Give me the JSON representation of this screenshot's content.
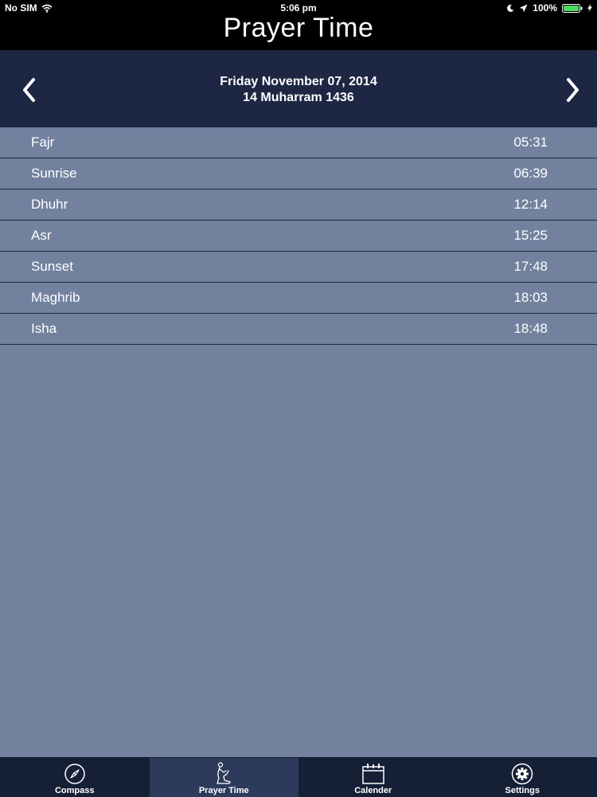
{
  "status_bar": {
    "carrier": "No SIM",
    "time": "5:06 pm",
    "battery": "100%"
  },
  "title": "Prayer Time",
  "date_header": {
    "gregorian": "Friday November 07, 2014",
    "hijri": "14 Muharram 1436"
  },
  "prayers": [
    {
      "name": "Fajr",
      "time": "05:31"
    },
    {
      "name": "Sunrise",
      "time": "06:39"
    },
    {
      "name": "Dhuhr",
      "time": "12:14"
    },
    {
      "name": "Asr",
      "time": "15:25"
    },
    {
      "name": "Sunset",
      "time": "17:48"
    },
    {
      "name": "Maghrib",
      "time": "18:03"
    },
    {
      "name": "Isha",
      "time": "18:48"
    }
  ],
  "tabs": [
    {
      "label": "Compass",
      "icon": "compass-icon"
    },
    {
      "label": "Prayer Time",
      "icon": "prayer-icon"
    },
    {
      "label": "Calender",
      "icon": "calendar-icon"
    },
    {
      "label": "Settings",
      "icon": "gear-icon"
    }
  ],
  "active_tab": "Prayer Time",
  "colors": {
    "background": "#72819e",
    "header": "#1d2743",
    "tab_bar": "#151f36",
    "tab_active": "#2c3a5c",
    "battery": "#4cd964"
  }
}
